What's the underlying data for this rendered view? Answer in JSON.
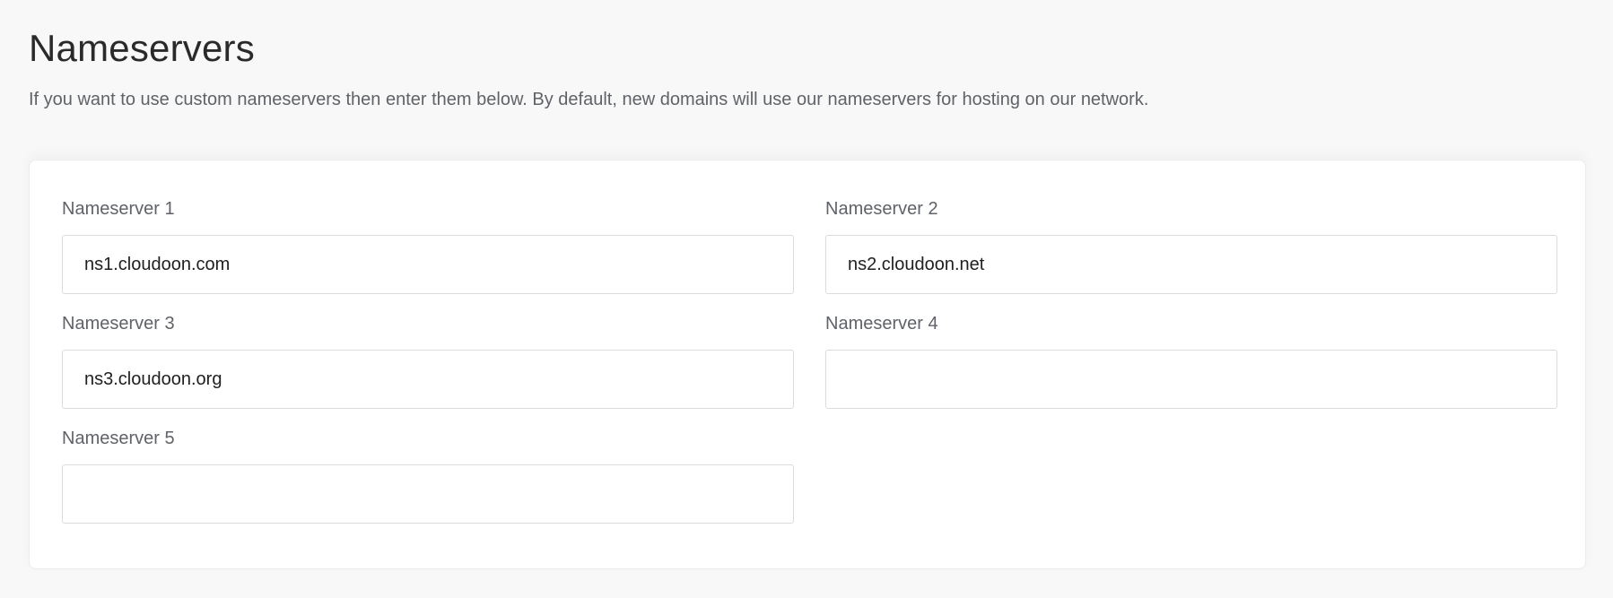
{
  "header": {
    "title": "Nameservers",
    "description": "If you want to use custom nameservers then enter them below. By default, new domains will use our nameservers for hosting on our network."
  },
  "form": {
    "fields": [
      {
        "label": "Nameserver 1",
        "value": "ns1.cloudoon.com",
        "placeholder": ""
      },
      {
        "label": "Nameserver 2",
        "value": "ns2.cloudoon.net",
        "placeholder": ""
      },
      {
        "label": "Nameserver 3",
        "value": "ns3.cloudoon.org",
        "placeholder": ""
      },
      {
        "label": "Nameserver 4",
        "value": "",
        "placeholder": ""
      },
      {
        "label": "Nameserver 5",
        "value": "",
        "placeholder": ""
      }
    ]
  }
}
